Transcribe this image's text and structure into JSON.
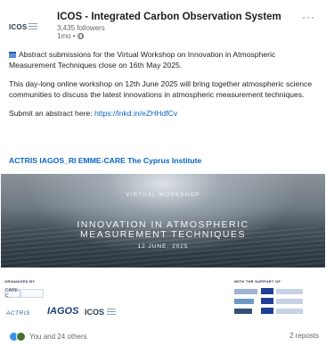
{
  "post": {
    "company": "ICOS - Integrated Carbon Observation System",
    "followers": "3,435 followers",
    "time": "1mo •",
    "logo_text": "ICOS",
    "para1": "Abstract submissions for the Virtual Workshop on Innovation in Atmospheric Measurement Techniques close on 16th May 2025.",
    "para2": "This day-long online workshop on 12th June 2025 will bring together atmospheric science communities to discuss the latest innovations in atmospheric measurement techniques.",
    "para3_prefix": "Submit an abstract here: ",
    "para3_link": "https://lnkd.in/eZHHdfCv",
    "tags": "ACTRIS IAGOS_RI EMME-CARE The Cyprus Institute"
  },
  "banner": {
    "top_label": "VIRTUAL WORKSHOP",
    "title_line1": "INNOVATION IN ATMOSPHERIC",
    "title_line2": "MEASUREMENT TECHNIQUES",
    "date": "12 JUNE, 2025"
  },
  "strip": {
    "organized_by": "ORGANIZED BY",
    "with_support": "WITH THE SUPPORT OF",
    "care_c": "CARE-C",
    "actris": "ACTRIS",
    "iagos": "IAGOS",
    "icos": "ICOS"
  },
  "footer": {
    "reactions_text": "You and 24 others",
    "reposts": "2 reposts"
  },
  "colors": {
    "link": "#0a66c2",
    "like_reaction": "#378fe9",
    "celebrate_reaction": "#44712e"
  }
}
